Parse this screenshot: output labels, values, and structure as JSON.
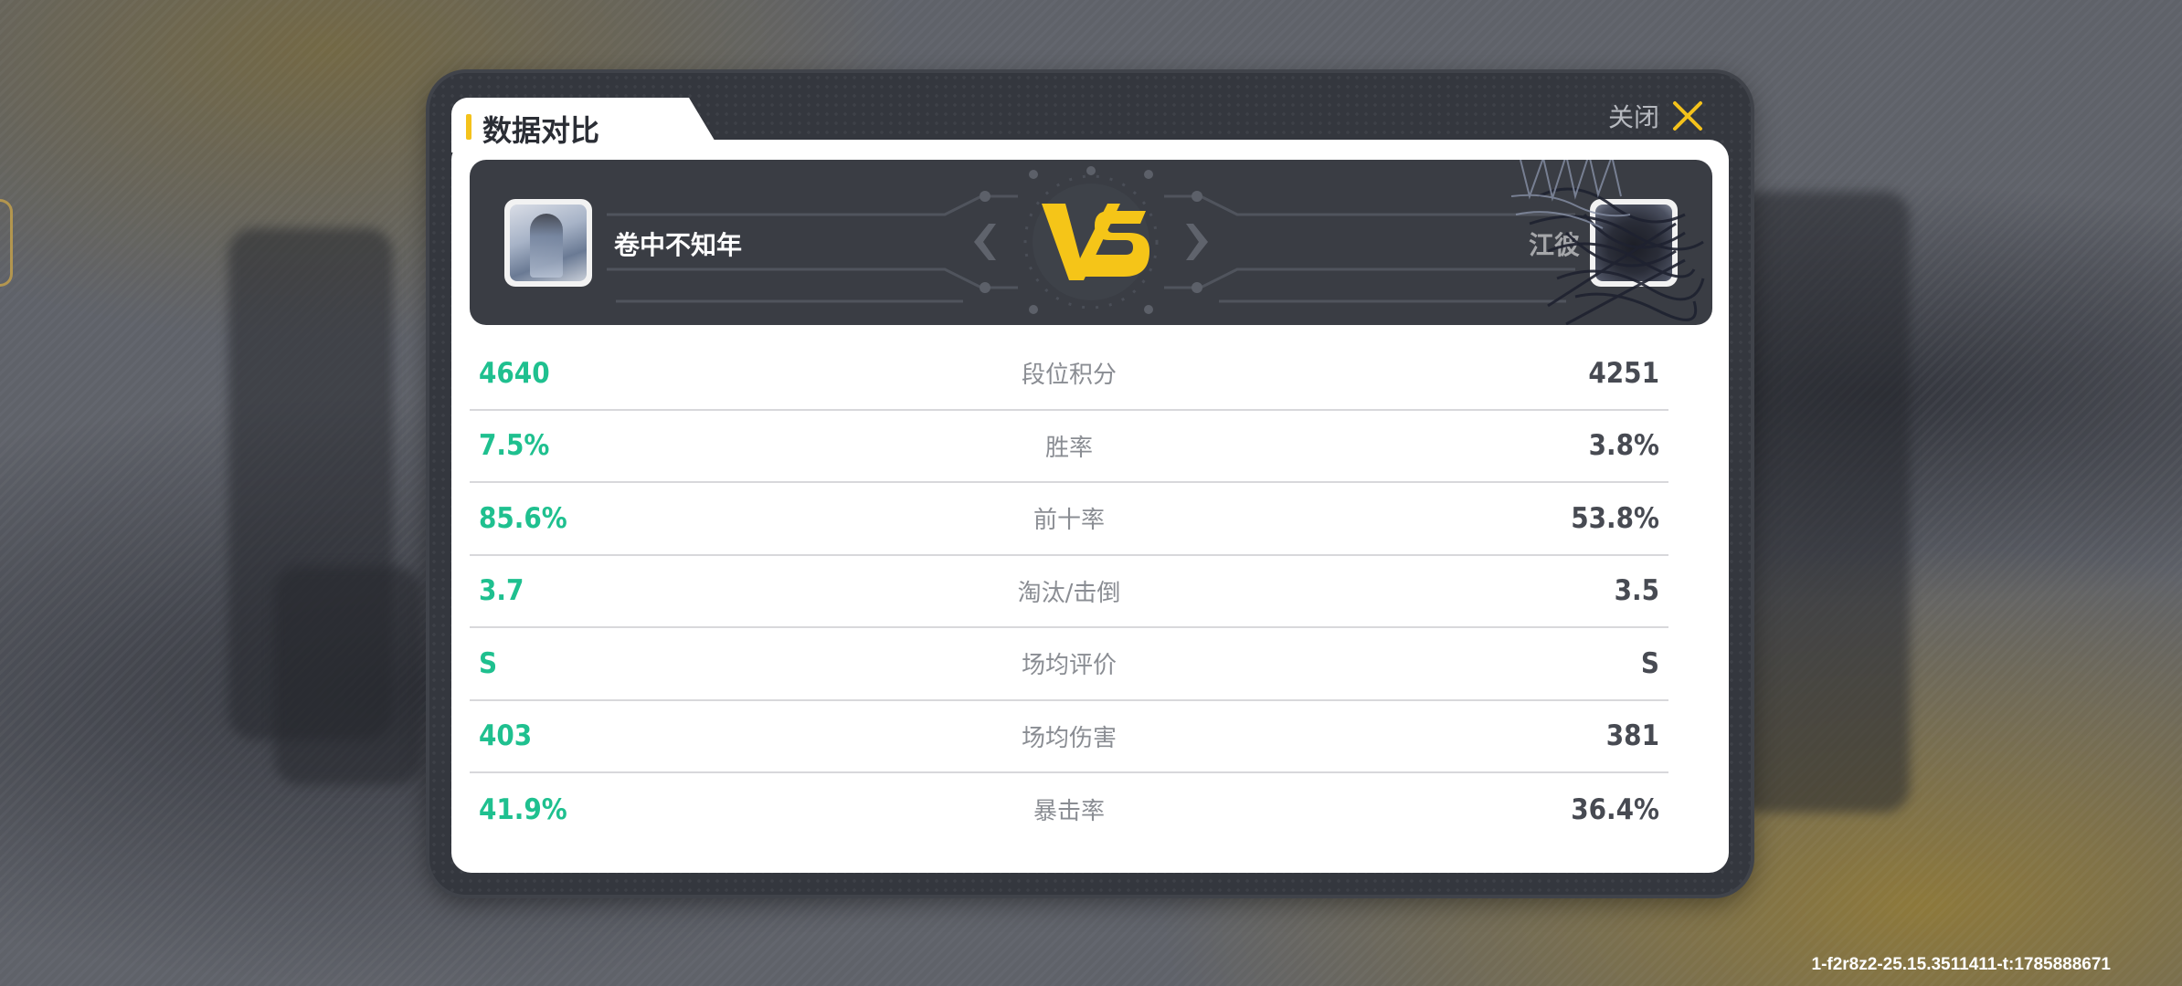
{
  "panel": {
    "title": "数据对比",
    "close_label": "关闭"
  },
  "players": {
    "left": {
      "name": "卷中不知年"
    },
    "right": {
      "name": "江彼"
    }
  },
  "vs_label": "VS",
  "stats": [
    {
      "left": "4640",
      "label": "段位积分",
      "right": "4251"
    },
    {
      "left": "7.5%",
      "label": "胜率",
      "right": "3.8%"
    },
    {
      "left": "85.6%",
      "label": "前十率",
      "right": "53.8%"
    },
    {
      "left": "3.7",
      "label": "淘汰/击倒",
      "right": "3.5"
    },
    {
      "left": "S",
      "label": "场均评价",
      "right": "S"
    },
    {
      "left": "403",
      "label": "场均伤害",
      "right": "381"
    },
    {
      "left": "41.9%",
      "label": "暴击率",
      "right": "36.4%"
    }
  ],
  "footer": {
    "id": "1-f2r8z2-25.15.3511411-t:1785888671"
  },
  "colors": {
    "accent_yellow": "#f4c21b",
    "left_value": "#1fc08f",
    "right_value": "#474a52"
  }
}
